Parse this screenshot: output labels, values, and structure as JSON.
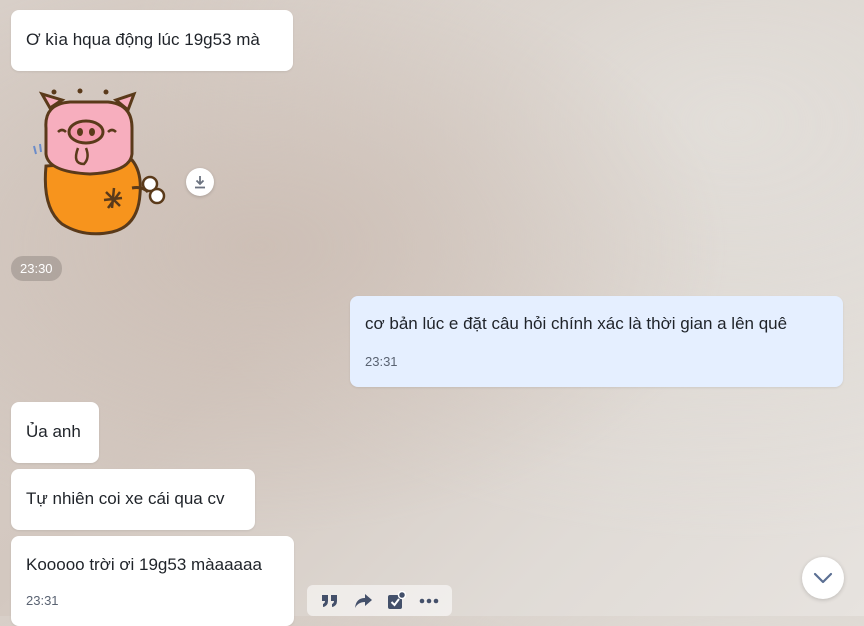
{
  "messages": [
    {
      "text": "Ơ kìa hqua động lúc 19g53 mà"
    },
    {
      "time_chip": "23:30"
    },
    {
      "text": "cơ bản lúc e đặt câu hỏi chính xác là thời gian a lên quê",
      "time": "23:31"
    },
    {
      "text": "Ủa anh"
    },
    {
      "text": "Tự nhiên coi xe cái qua cv"
    },
    {
      "text": "Kooooo trời ơi 19g53 màaaaaa",
      "time": "23:31"
    }
  ],
  "sticker": {
    "icon": "pig-sticker-icon"
  },
  "icons": {
    "download": "download-icon",
    "quote": "quote-icon",
    "forward": "forward-icon",
    "task": "task-icon",
    "more": "more-icon",
    "scroll_down": "chevron-down-icon"
  },
  "colors": {
    "incoming_bubble": "#ffffff",
    "outgoing_bubble": "#e5efff",
    "toolbar_icon": "#44506a"
  }
}
